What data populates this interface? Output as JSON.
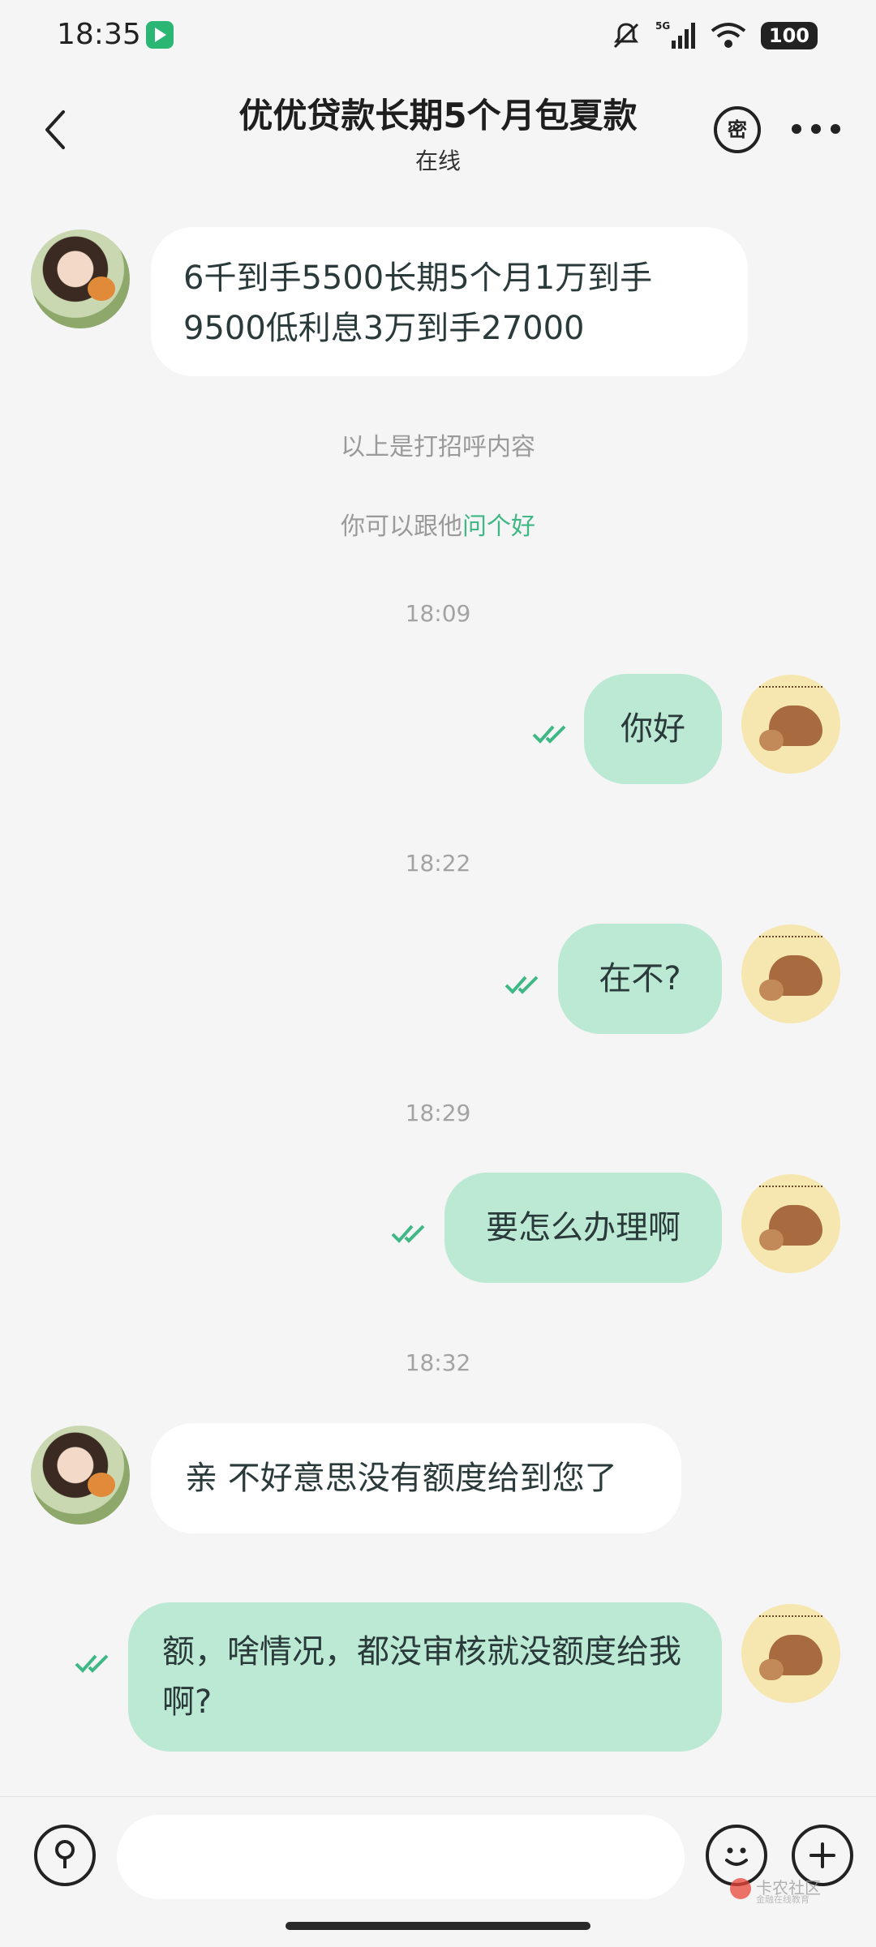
{
  "status_bar": {
    "time": "18:35",
    "network": "5G",
    "battery": "100",
    "icons": [
      "app-icon",
      "mute-icon",
      "signal-icon",
      "wifi-icon",
      "battery-icon"
    ]
  },
  "header": {
    "title": "优优贷款长期5个月包夏款",
    "status": "在线",
    "secret_label": "密"
  },
  "system": {
    "greeting_note": "以上是打招呼内容",
    "prompt_prefix": "你可以跟他",
    "prompt_link": "问个好"
  },
  "messages": [
    {
      "side": "in",
      "text": "6千到手5500长期5个月1万到手9500低利息3万到手27000"
    },
    {
      "side": "out",
      "time": "18:09",
      "text": "你好"
    },
    {
      "side": "out",
      "time": "18:22",
      "text": "在不?"
    },
    {
      "side": "out",
      "time": "18:29",
      "text": "要怎么办理啊"
    },
    {
      "side": "in",
      "time": "18:32",
      "text": "亲 不好意思没有额度给到您了"
    },
    {
      "side": "out",
      "text": "额，啥情况，都没审核就没额度给我啊?"
    }
  ],
  "input": {
    "placeholder": "",
    "value": ""
  },
  "watermark": {
    "title": "卡农社区",
    "subtitle": "金融在线教育"
  },
  "colors": {
    "outgoing_bubble": "#bce9d4",
    "incoming_bubble": "#ffffff",
    "accent": "#3fb886",
    "background": "#f5f5f5"
  }
}
